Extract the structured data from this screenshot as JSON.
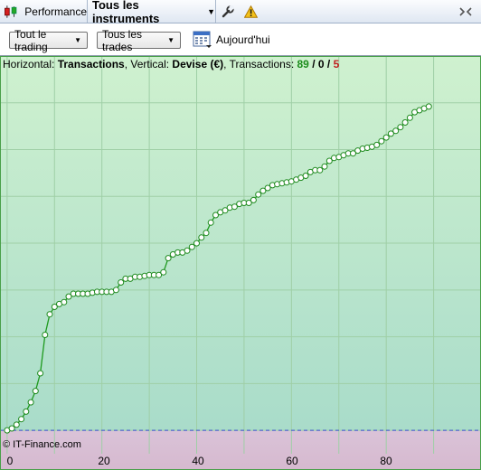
{
  "tabs": {
    "performance_label": "Performance",
    "instruments_label": "Tous les instruments"
  },
  "toolbar": {
    "trading_filter": "Tout le trading",
    "trades_filter": "Tous les trades",
    "date_label": "Aujourd'hui"
  },
  "info": {
    "horizontal_label": "Horizontal: ",
    "horizontal_value": "Transactions",
    "vertical_label": ", Vertical: ",
    "vertical_value": "Devise (€)",
    "transactions_label": ", Transactions: ",
    "wins": "89",
    "sep1": " / ",
    "neutral": "0",
    "sep2": " / ",
    "losses": "5"
  },
  "copyright": "© IT-Finance.com",
  "icons": {
    "chart_type": "candlestick-icon",
    "instrument_dropdown": "chevron-down-icon",
    "settings": "wrench-icon",
    "warning": "warning-icon",
    "overflow": "overflow-arrows-icon",
    "calendar": "calendar-icon"
  },
  "colors": {
    "profit_area": "#c6ecc8",
    "loss_area": "#d9bfd3",
    "equity_line": "#1e9a1e",
    "zero_line": "#3a4fd0"
  },
  "chart_data": {
    "type": "line",
    "title": "",
    "xlabel": "",
    "ylabel": "",
    "x_tick_labels": [
      "0",
      "20",
      "40",
      "60",
      "80"
    ],
    "xlim": [
      -1.5,
      100
    ],
    "ylim": [
      -25,
      400
    ],
    "grid": true,
    "series": [
      {
        "values": [
          0,
          2,
          6,
          12,
          20,
          30,
          42,
          61,
          102,
          124,
          132,
          135,
          137,
          143,
          146,
          146,
          146,
          146,
          147,
          148,
          148,
          148,
          148,
          150,
          158,
          162,
          162,
          164,
          164,
          165,
          166,
          166,
          166,
          169,
          184,
          188,
          190,
          190,
          192,
          196,
          200,
          206,
          211,
          222,
          230,
          233,
          235,
          238,
          239,
          242,
          243,
          243,
          246,
          252,
          256,
          259,
          262,
          263,
          264,
          265,
          266,
          268,
          270,
          272,
          276,
          278,
          278,
          282,
          288,
          291,
          292,
          294,
          296,
          296,
          299,
          301,
          302,
          303,
          305,
          309,
          313,
          317,
          320,
          324,
          329,
          334,
          340,
          342,
          344,
          346
        ]
      }
    ]
  }
}
